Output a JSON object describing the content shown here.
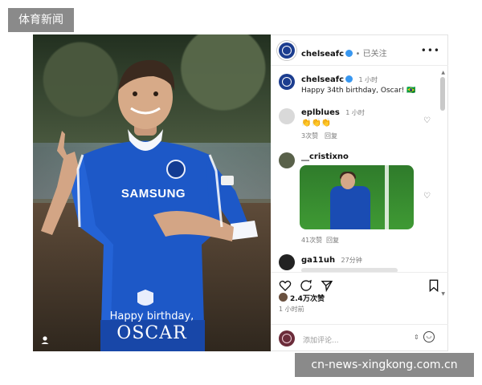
{
  "watermarks": {
    "top_label": "体育新闻",
    "bottom_label": "cn-news-xingkong.com.cn"
  },
  "photo": {
    "caption_line1": "Happy birthday,",
    "caption_line2": "OSCAR",
    "shirt_sponsor": "SAMSUNG"
  },
  "post": {
    "header": {
      "username": "chelseafc",
      "follow_status": "• 已关注"
    },
    "caption": {
      "username": "chelseafc",
      "time": "1 小时",
      "text": "Happy 34th birthday, Oscar! 🇧🇷"
    },
    "comments": [
      {
        "username": "eplblues",
        "time": "1 小时",
        "text": "👏👏👏",
        "likes": "3次赞",
        "reply": "回复"
      },
      {
        "username": "__cristixno",
        "time": "",
        "text": "",
        "likes": "41次赞",
        "reply": "回复"
      },
      {
        "username": "ga11uh",
        "time": "27分钟",
        "text": "",
        "likes": "",
        "reply": ""
      }
    ],
    "like_count": "2.4万次赞",
    "posted_ago": "1 小时前",
    "composer_placeholder": "添加评论..."
  }
}
